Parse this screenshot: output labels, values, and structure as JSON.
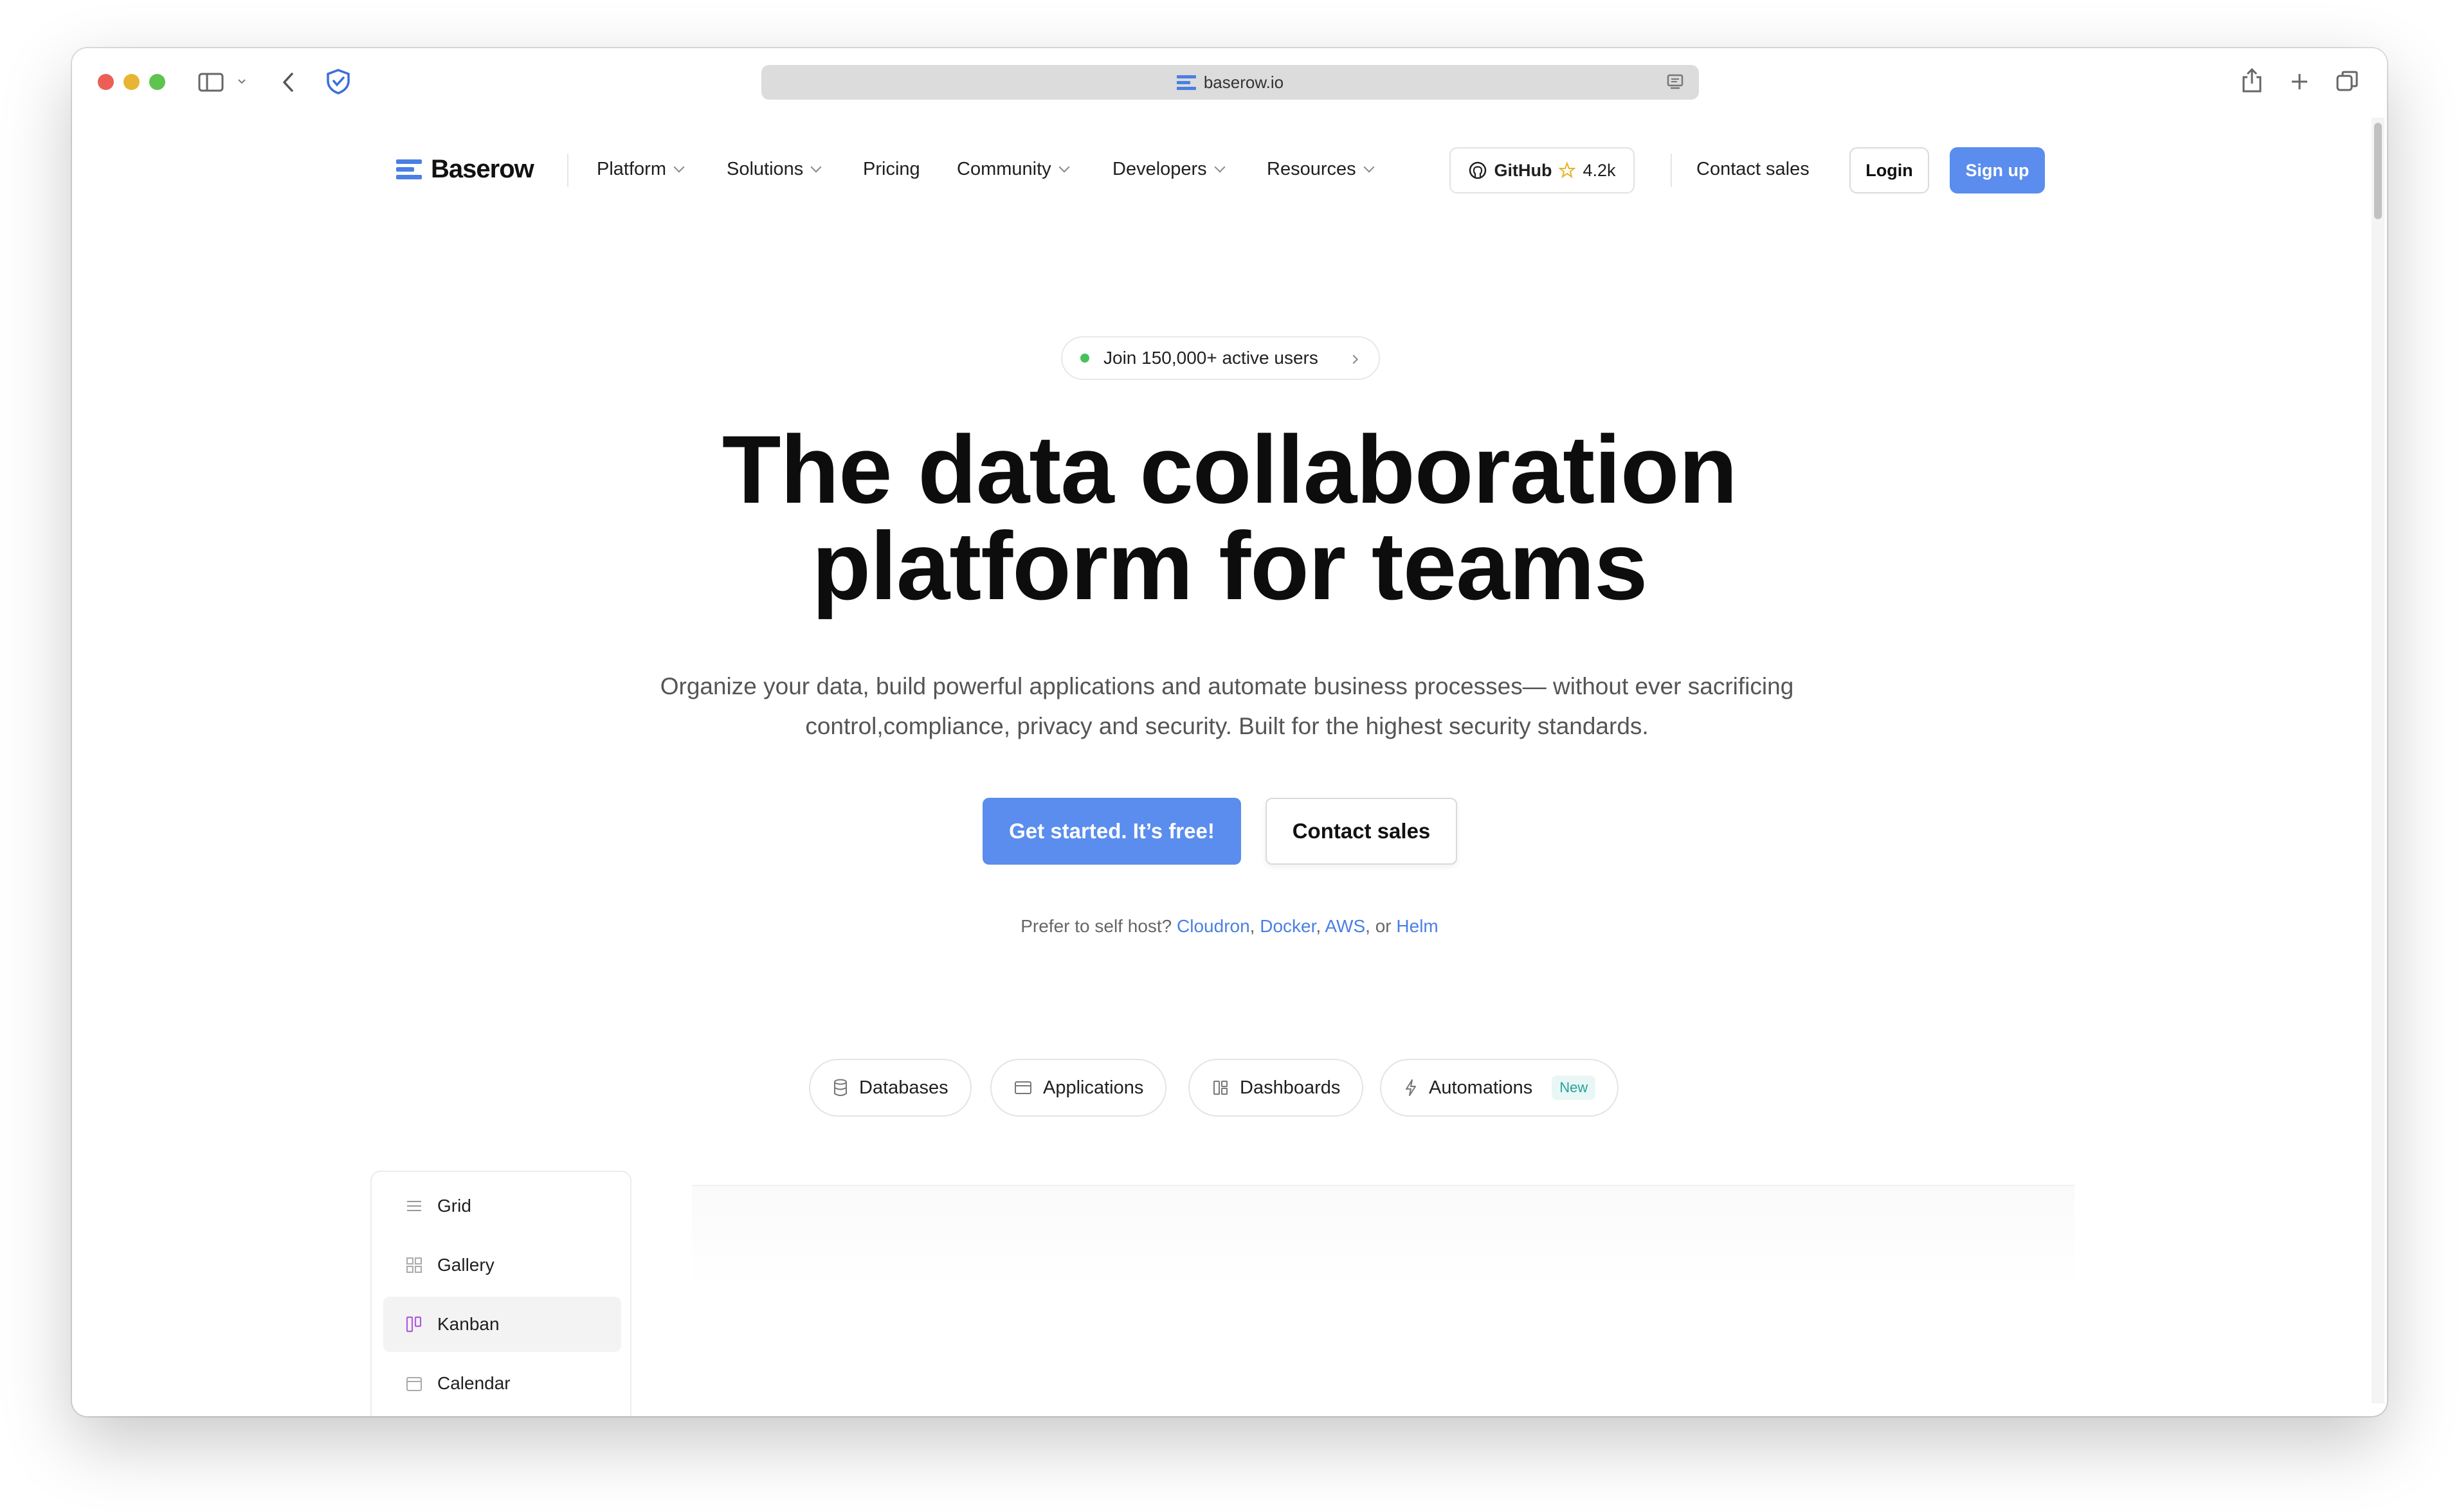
{
  "browser": {
    "url": "baserow.io"
  },
  "nav": {
    "logo_text": "Baserow",
    "items": [
      {
        "label": "Platform"
      },
      {
        "label": "Solutions"
      },
      {
        "label": "Pricing"
      },
      {
        "label": "Community"
      },
      {
        "label": "Developers"
      },
      {
        "label": "Resources"
      }
    ],
    "github_label": "GitHub",
    "github_stars": "4.2k",
    "contact_sales": "Contact sales",
    "login": "Login",
    "signup": "Sign up"
  },
  "hero": {
    "badge": "Join 150,000+ active users",
    "headline_line1": "The data collaboration",
    "headline_line2": "platform for teams",
    "subtitle_line1": "Organize your data, build powerful applications and automate business processes— without ever sacrificing",
    "subtitle_line2": "control,compliance, privacy and security. Built for the highest security standards.",
    "cta_primary": "Get started. It’s free!",
    "cta_secondary": "Contact sales",
    "selfhost_prefix": "Prefer to self host?",
    "selfhost_links": [
      "Cloudron",
      "Docker",
      "AWS",
      "Helm"
    ],
    "selfhost_or": "or"
  },
  "feature_tabs": [
    {
      "label": "Databases",
      "icon": "database-icon"
    },
    {
      "label": "Applications",
      "icon": "window-icon"
    },
    {
      "label": "Dashboards",
      "icon": "dashboard-icon"
    },
    {
      "label": "Automations",
      "icon": "bolt-icon",
      "badge": "New"
    }
  ],
  "demo_views": [
    {
      "label": "Grid",
      "icon": "grid-lines-icon"
    },
    {
      "label": "Gallery",
      "icon": "gallery-icon"
    },
    {
      "label": "Kanban",
      "icon": "kanban-icon",
      "active": true
    },
    {
      "label": "Calendar",
      "icon": "calendar-icon"
    }
  ],
  "colors": {
    "brand_blue": "#5a8ded",
    "logo_blue": "#4a7fe3",
    "kanban_purple": "#b15ddb",
    "new_badge_teal": "#2aa198",
    "online_green": "#49c15a"
  }
}
